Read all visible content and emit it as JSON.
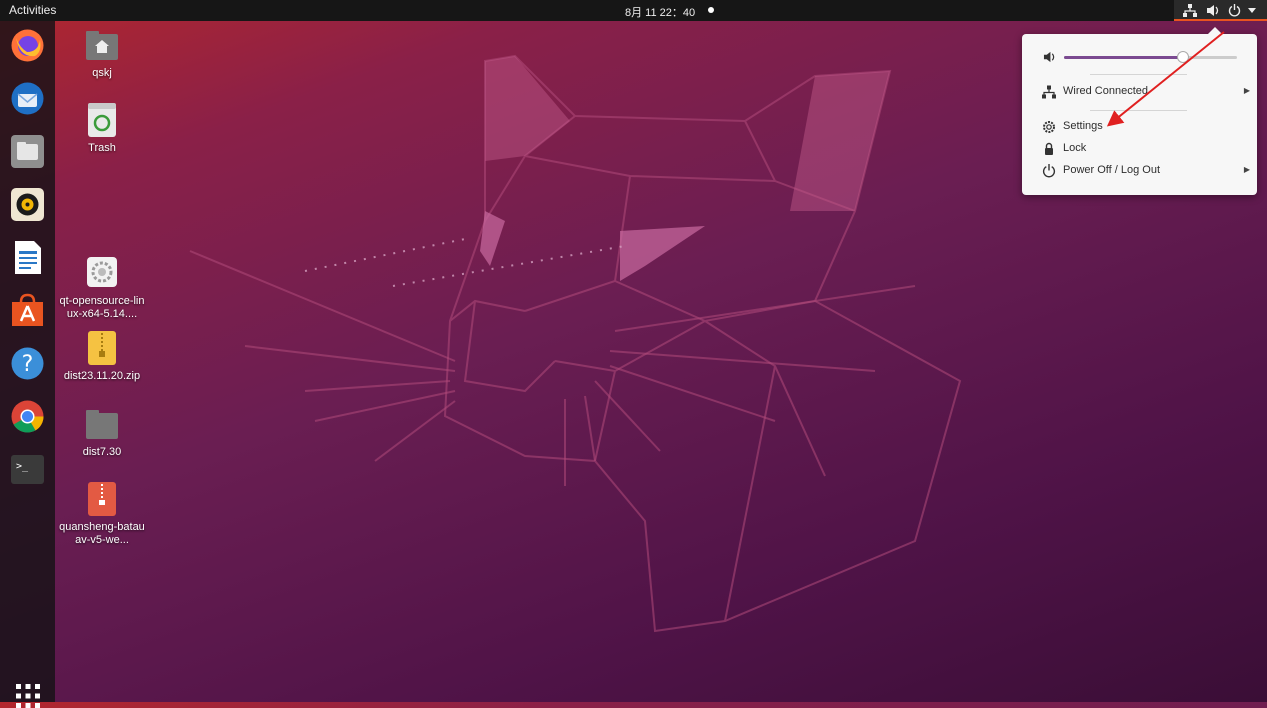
{
  "topbar": {
    "activities_label": "Activities",
    "clock": "8月 11  22：40",
    "tray_icons": [
      "network-icon",
      "volume-icon",
      "power-icon",
      "chevron-down-icon"
    ]
  },
  "dock": {
    "apps": [
      "firefox",
      "thunderbird",
      "files",
      "rhythmbox",
      "libreoffice-writer",
      "ubuntu-software",
      "help",
      "chrome",
      "terminal"
    ],
    "show_apps": "app-grid-icon"
  },
  "desktop": {
    "icons": [
      {
        "label": "qskj"
      },
      {
        "label": "Trash"
      },
      {
        "label": "qt-opensource-linux-x64-5.14...."
      },
      {
        "label": "dist23.11.20.zip"
      },
      {
        "label": "dist7.30"
      },
      {
        "label": "quansheng-batauav-v5-we..."
      }
    ]
  },
  "menu": {
    "volume_level": 0.69,
    "wired": "Wired Connected",
    "settings": "Settings",
    "lock": "Lock",
    "power": "Power Off / Log Out"
  },
  "colors": {
    "accent": "#e95420",
    "slider": "#7b4a91",
    "annotation": "#e02020"
  }
}
